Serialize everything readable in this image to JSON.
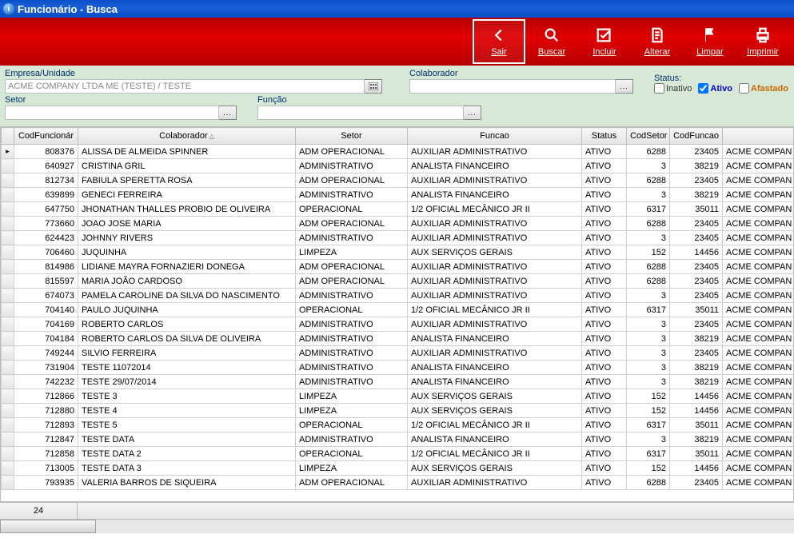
{
  "window": {
    "title": "Funcionário - Busca"
  },
  "toolbar": {
    "sair": {
      "label": "Sair"
    },
    "buscar": {
      "label": "Buscar"
    },
    "incluir": {
      "label": "Incluir"
    },
    "alterar": {
      "label": "Alterar"
    },
    "limpar": {
      "label": "Limpar"
    },
    "imprimir": {
      "label": "Imprimir"
    }
  },
  "filters": {
    "empresa": {
      "label": "Empresa/Unidade",
      "value": "ACME COMPANY LTDA ME (TESTE) / TESTE"
    },
    "colaborador": {
      "label": "Colaborador",
      "value": ""
    },
    "setor": {
      "label": "Setor",
      "value": ""
    },
    "funcao": {
      "label": "Função",
      "value": ""
    },
    "status": {
      "label": "Status:",
      "inativo": {
        "label": "Inativo",
        "checked": false
      },
      "ativo": {
        "label": "Ativo",
        "checked": true
      },
      "afastado": {
        "label": "Afastado",
        "checked": false
      }
    }
  },
  "grid": {
    "columns": {
      "cod": "CodFuncionár",
      "colab": "Colaborador",
      "setor": "Setor",
      "funcao": "Funcao",
      "status": "Status",
      "codsetor": "CodSetor",
      "codfuncao": "CodFuncao"
    },
    "rows": [
      {
        "cod": "808376",
        "colab": "ALISSA DE ALMEIDA SPINNER",
        "setor": "ADM OPERACIONAL",
        "funcao": "AUXILIAR ADMINISTRATIVO",
        "status": "ATIVO",
        "codsetor": "6288",
        "codfuncao": "23405",
        "emp": "ACME COMPAN"
      },
      {
        "cod": "640927",
        "colab": "CRISTINA GRIL",
        "setor": "ADMINISTRATIVO",
        "funcao": "ANALISTA FINANCEIRO",
        "status": "ATIVO",
        "codsetor": "3",
        "codfuncao": "38219",
        "emp": "ACME COMPAN"
      },
      {
        "cod": "812734",
        "colab": "FABIULA SPERETTA ROSA",
        "setor": "ADM OPERACIONAL",
        "funcao": "AUXILIAR ADMINISTRATIVO",
        "status": "ATIVO",
        "codsetor": "6288",
        "codfuncao": "23405",
        "emp": "ACME COMPAN"
      },
      {
        "cod": "639899",
        "colab": "GENECI FERREIRA",
        "setor": "ADMINISTRATIVO",
        "funcao": "ANALISTA FINANCEIRO",
        "status": "ATIVO",
        "codsetor": "3",
        "codfuncao": "38219",
        "emp": "ACME COMPAN"
      },
      {
        "cod": "647750",
        "colab": "JHONATHAN THALLES PROBIO DE OLIVEIRA",
        "setor": "OPERACIONAL",
        "funcao": "1/2 OFICIAL MECÂNICO JR II",
        "status": "ATIVO",
        "codsetor": "6317",
        "codfuncao": "35011",
        "emp": "ACME COMPAN"
      },
      {
        "cod": "773660",
        "colab": "JOAO JOSE MARIA",
        "setor": "ADM OPERACIONAL",
        "funcao": "AUXILIAR ADMINISTRATIVO",
        "status": "ATIVO",
        "codsetor": "6288",
        "codfuncao": "23405",
        "emp": "ACME COMPAN"
      },
      {
        "cod": "624423",
        "colab": "JOHNNY RIVERS",
        "setor": "ADMINISTRATIVO",
        "funcao": "AUXILIAR ADMINISTRATIVO",
        "status": "ATIVO",
        "codsetor": "3",
        "codfuncao": "23405",
        "emp": "ACME COMPAN"
      },
      {
        "cod": "706460",
        "colab": "JUQUINHA",
        "setor": "LIMPEZA",
        "funcao": "AUX SERVIÇOS GERAIS",
        "status": "ATIVO",
        "codsetor": "152",
        "codfuncao": "14456",
        "emp": "ACME COMPAN"
      },
      {
        "cod": "814986",
        "colab": "LIDIANE MAYRA FORNAZIERI DONEGA",
        "setor": "ADM OPERACIONAL",
        "funcao": "AUXILIAR ADMINISTRATIVO",
        "status": "ATIVO",
        "codsetor": "6288",
        "codfuncao": "23405",
        "emp": "ACME COMPAN"
      },
      {
        "cod": "815597",
        "colab": "MARIA JOÃO CARDOSO",
        "setor": "ADM OPERACIONAL",
        "funcao": "AUXILIAR ADMINISTRATIVO",
        "status": "ATIVO",
        "codsetor": "6288",
        "codfuncao": "23405",
        "emp": "ACME COMPAN"
      },
      {
        "cod": "674073",
        "colab": "PAMELA CAROLINE DA SILVA DO NASCIMENTO",
        "setor": "ADMINISTRATIVO",
        "funcao": "AUXILIAR ADMINISTRATIVO",
        "status": "ATIVO",
        "codsetor": "3",
        "codfuncao": "23405",
        "emp": "ACME COMPAN"
      },
      {
        "cod": "704140",
        "colab": "PAULO JUQUINHA",
        "setor": "OPERACIONAL",
        "funcao": "1/2 OFICIAL MECÂNICO JR II",
        "status": "ATIVO",
        "codsetor": "6317",
        "codfuncao": "35011",
        "emp": "ACME COMPAN"
      },
      {
        "cod": "704169",
        "colab": "ROBERTO CARLOS",
        "setor": "ADMINISTRATIVO",
        "funcao": "AUXILIAR ADMINISTRATIVO",
        "status": "ATIVO",
        "codsetor": "3",
        "codfuncao": "23405",
        "emp": "ACME COMPAN"
      },
      {
        "cod": "704184",
        "colab": "ROBERTO CARLOS DA SILVA DE OLIVEIRA",
        "setor": "ADMINISTRATIVO",
        "funcao": "ANALISTA FINANCEIRO",
        "status": "ATIVO",
        "codsetor": "3",
        "codfuncao": "38219",
        "emp": "ACME COMPAN"
      },
      {
        "cod": "749244",
        "colab": "SILVIO FERREIRA",
        "setor": "ADMINISTRATIVO",
        "funcao": "AUXILIAR ADMINISTRATIVO",
        "status": "ATIVO",
        "codsetor": "3",
        "codfuncao": "23405",
        "emp": "ACME COMPAN"
      },
      {
        "cod": "731904",
        "colab": "TESTE 11072014",
        "setor": "ADMINISTRATIVO",
        "funcao": "ANALISTA FINANCEIRO",
        "status": "ATIVO",
        "codsetor": "3",
        "codfuncao": "38219",
        "emp": "ACME COMPAN"
      },
      {
        "cod": "742232",
        "colab": "TESTE 29/07/2014",
        "setor": "ADMINISTRATIVO",
        "funcao": "ANALISTA FINANCEIRO",
        "status": "ATIVO",
        "codsetor": "3",
        "codfuncao": "38219",
        "emp": "ACME COMPAN"
      },
      {
        "cod": "712866",
        "colab": "TESTE 3",
        "setor": "LIMPEZA",
        "funcao": "AUX SERVIÇOS GERAIS",
        "status": "ATIVO",
        "codsetor": "152",
        "codfuncao": "14456",
        "emp": "ACME COMPAN"
      },
      {
        "cod": "712880",
        "colab": "TESTE 4",
        "setor": "LIMPEZA",
        "funcao": "AUX SERVIÇOS GERAIS",
        "status": "ATIVO",
        "codsetor": "152",
        "codfuncao": "14456",
        "emp": "ACME COMPAN"
      },
      {
        "cod": "712893",
        "colab": "TESTE 5",
        "setor": "OPERACIONAL",
        "funcao": "1/2 OFICIAL MECÂNICO JR II",
        "status": "ATIVO",
        "codsetor": "6317",
        "codfuncao": "35011",
        "emp": "ACME COMPAN"
      },
      {
        "cod": "712847",
        "colab": "TESTE DATA",
        "setor": "ADMINISTRATIVO",
        "funcao": "ANALISTA FINANCEIRO",
        "status": "ATIVO",
        "codsetor": "3",
        "codfuncao": "38219",
        "emp": "ACME COMPAN"
      },
      {
        "cod": "712858",
        "colab": "TESTE DATA 2",
        "setor": "OPERACIONAL",
        "funcao": "1/2 OFICIAL MECÂNICO JR II",
        "status": "ATIVO",
        "codsetor": "6317",
        "codfuncao": "35011",
        "emp": "ACME COMPAN"
      },
      {
        "cod": "713005",
        "colab": "TESTE DATA 3",
        "setor": "LIMPEZA",
        "funcao": "AUX SERVIÇOS GERAIS",
        "status": "ATIVO",
        "codsetor": "152",
        "codfuncao": "14456",
        "emp": "ACME COMPAN"
      },
      {
        "cod": "793935",
        "colab": "VALERIA BARROS DE SIQUEIRA",
        "setor": "ADM OPERACIONAL",
        "funcao": "AUXILIAR ADMINISTRATIVO",
        "status": "ATIVO",
        "codsetor": "6288",
        "codfuncao": "23405",
        "emp": "ACME COMPAN"
      }
    ]
  },
  "footer": {
    "count": "24"
  }
}
